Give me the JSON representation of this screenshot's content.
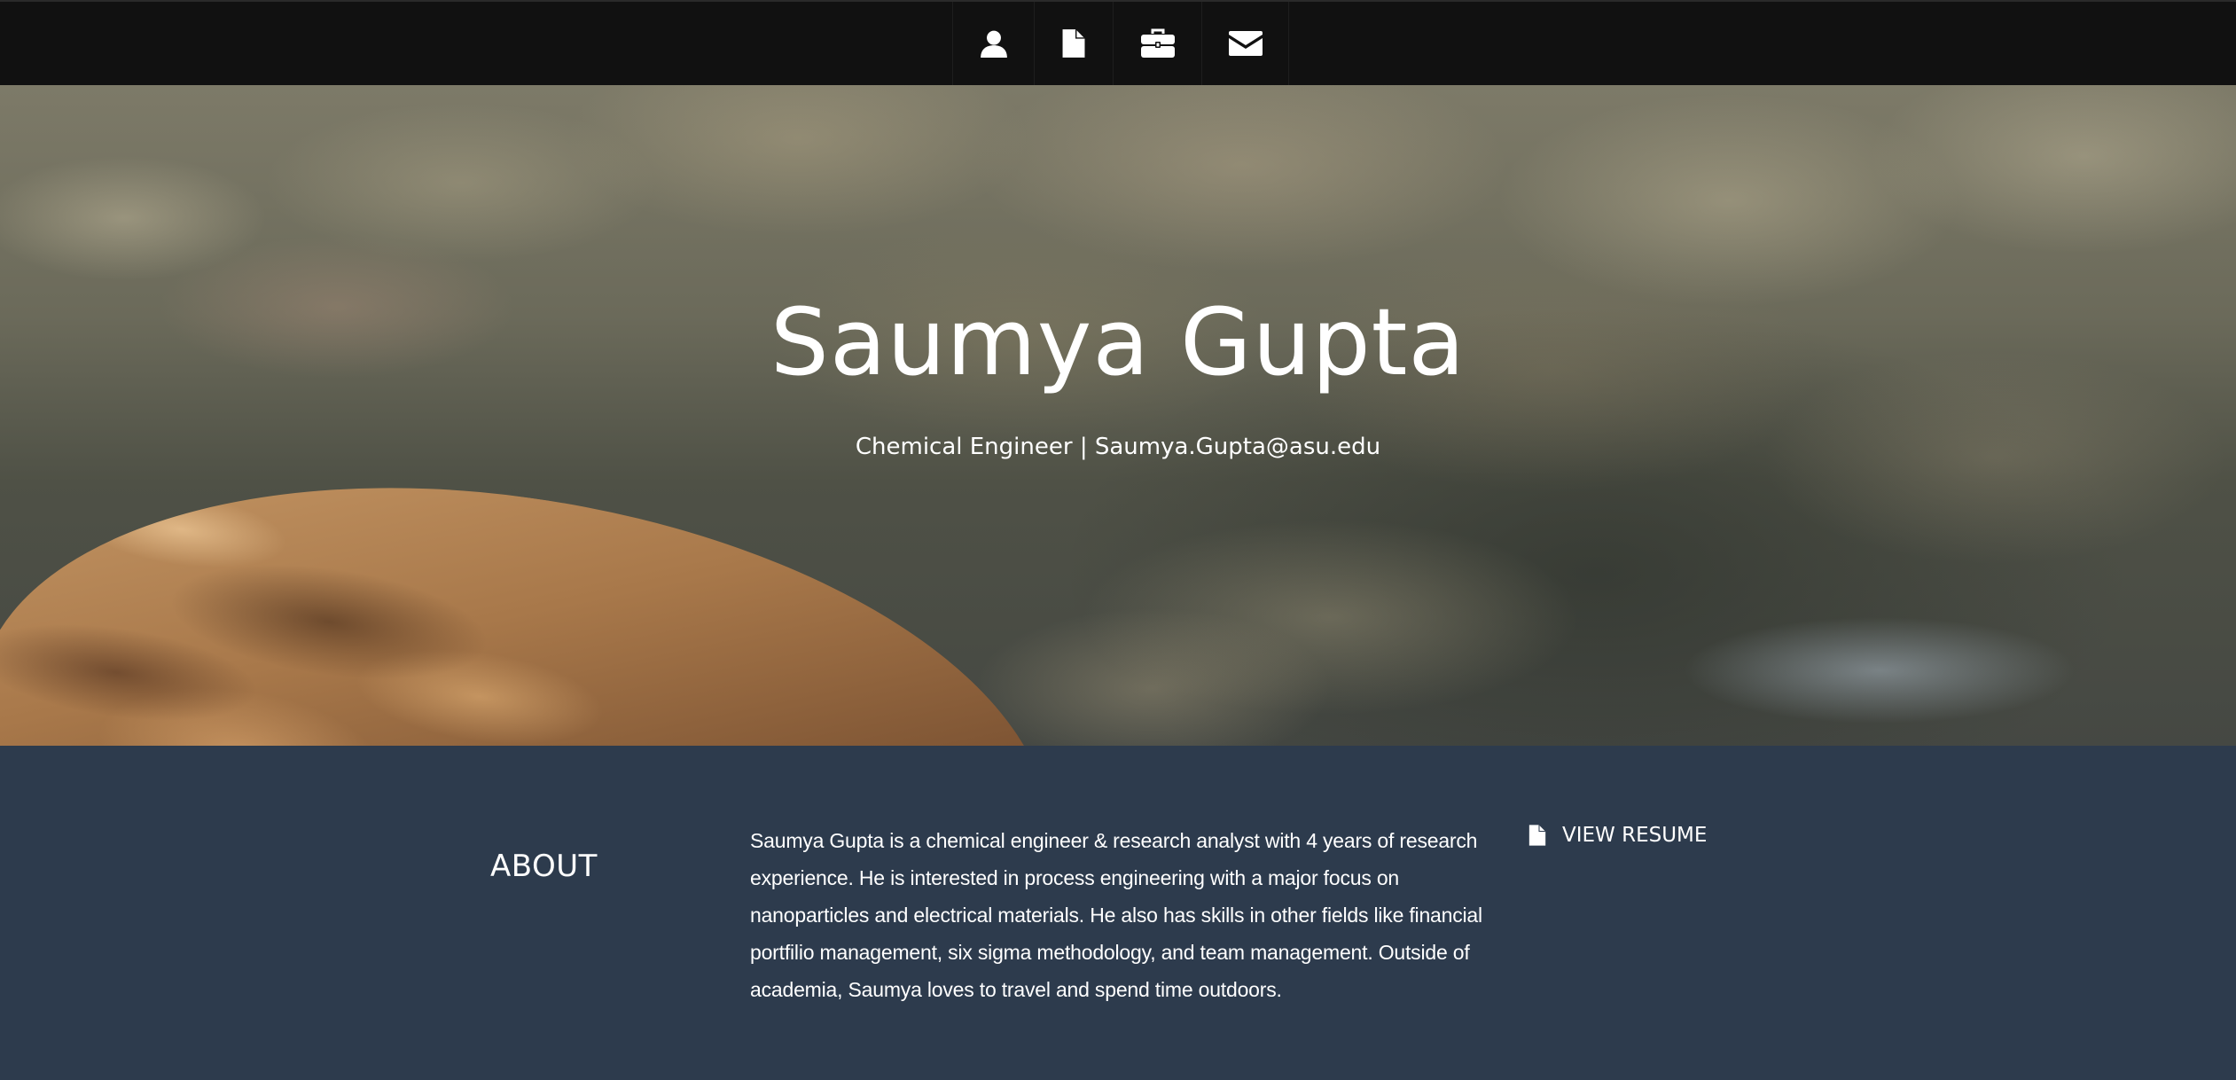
{
  "nav": {
    "items": [
      {
        "icon": "user-icon",
        "target": "about"
      },
      {
        "icon": "file-icon",
        "target": "resume"
      },
      {
        "icon": "briefcase-icon",
        "target": "portfolio"
      },
      {
        "icon": "envelope-icon",
        "target": "contact"
      }
    ]
  },
  "hero": {
    "name": "Saumya Gupta",
    "subtitle": "Chemical Engineer | Saumya.Gupta@asu.edu"
  },
  "about": {
    "title": "ABOUT",
    "text": "Saumya Gupta is a chemical engineer & research analyst with 4 years of research experience. He is interested in process engineering with a major focus on nanoparticles and electrical materials. He also has skills in other fields like financial portfilio management, six sigma methodology, and team management. Outside of academia, Saumya loves to travel and spend time outdoors.",
    "resume_link": {
      "icon": "file-icon",
      "label": "VIEW RESUME"
    }
  },
  "colors": {
    "nav_bg": "#111111",
    "about_bg": "#2d3b4d",
    "text": "#ffffff"
  }
}
